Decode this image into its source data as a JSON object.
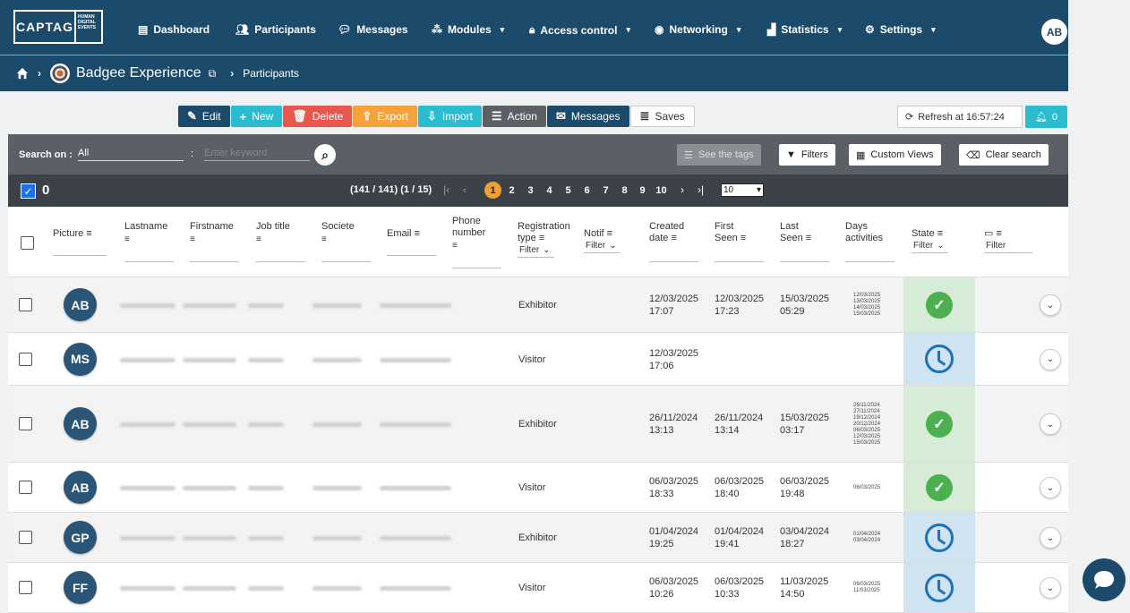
{
  "logo": {
    "main": "CAPTAG",
    "sub1": "HUMAN",
    "sub2": "DIGITAL",
    "sub3": "EVENTS"
  },
  "nav": [
    {
      "label": "Dashboard",
      "icon": "dashboard-icon"
    },
    {
      "label": "Participants",
      "icon": "users-icon"
    },
    {
      "label": "Messages",
      "icon": "chat-icon"
    },
    {
      "label": "Modules",
      "icon": "modules-icon"
    },
    {
      "label": "Access control",
      "icon": "lock-icon"
    },
    {
      "label": "Networking",
      "icon": "location-icon"
    },
    {
      "label": "Statistics",
      "icon": "chart-icon"
    },
    {
      "label": "Settings",
      "icon": "gear-icon"
    }
  ],
  "user": {
    "initials": "AB"
  },
  "breadcrumb": {
    "event": "Badgee Experience",
    "page": "Participants"
  },
  "toolbar": {
    "edit": "Edit",
    "new": "New",
    "delete": "Delete",
    "export": "Export",
    "import": "Import",
    "action": "Action",
    "messages": "Messages",
    "saves": "Saves"
  },
  "refresh": {
    "label": "Refresh at 16:57:24"
  },
  "notifications": {
    "count": "0"
  },
  "search": {
    "label": "Search on :",
    "field": "All",
    "colon": ":",
    "placeholder": "Enter keyword"
  },
  "search_buttons": {
    "tags": "See the tags",
    "filters": "Filters",
    "views": "Custom Views",
    "clear": "Clear search"
  },
  "pager": {
    "selected": "0",
    "info": "(141 / 141) (1 / 15)",
    "pages": [
      "1",
      "2",
      "3",
      "4",
      "5",
      "6",
      "7",
      "8",
      "9",
      "10"
    ],
    "per_page": "10"
  },
  "columns": {
    "picture": "Picture",
    "lastname": "Lastname",
    "firstname": "Firstname",
    "jobtitle": "Job title",
    "societe": "Societe",
    "email": "Email",
    "phone1": "Phone",
    "phone2": "number",
    "regtype1": "Registration",
    "regtype2": "type",
    "notif": "Notif",
    "created1": "Created",
    "created2": "date",
    "first1": "First",
    "first2": "Seen",
    "last1": "Last",
    "last2": "Seen",
    "days1": "Days",
    "days2": "activities",
    "state": "State",
    "filter": "Filter"
  },
  "rows": [
    {
      "initials": "AB",
      "type": "Exhibitor",
      "created": [
        "12/03/2025",
        "17:07"
      ],
      "first": [
        "12/03/2025",
        "17:23"
      ],
      "last": [
        "15/03/2025",
        "05:29"
      ],
      "days": [
        "12/03/2025",
        "13/03/2025",
        "14/03/2025",
        "15/03/2025"
      ],
      "state": "ok"
    },
    {
      "initials": "MS",
      "type": "Visitor",
      "created": [
        "12/03/2025",
        "17:06"
      ],
      "first": [
        "",
        ""
      ],
      "last": [
        "",
        ""
      ],
      "days": [],
      "state": "wait"
    },
    {
      "initials": "AB",
      "type": "Exhibitor",
      "created": [
        "26/11/2024",
        "13:13"
      ],
      "first": [
        "26/11/2024",
        "13:14"
      ],
      "last": [
        "15/03/2025",
        "03:17"
      ],
      "days": [
        "26/11/2024",
        "27/11/2024",
        "19/12/2024",
        "20/12/2024",
        "06/03/2025",
        "12/03/2025",
        "15/03/2025"
      ],
      "state": "ok"
    },
    {
      "initials": "AB",
      "type": "Visitor",
      "created": [
        "06/03/2025",
        "18:33"
      ],
      "first": [
        "06/03/2025",
        "18:40"
      ],
      "last": [
        "06/03/2025",
        "19:48"
      ],
      "days": [
        "06/03/2025"
      ],
      "state": "ok"
    },
    {
      "initials": "GP",
      "type": "Exhibitor",
      "created": [
        "01/04/2024",
        "19:25"
      ],
      "first": [
        "01/04/2024",
        "19:41"
      ],
      "last": [
        "03/04/2024",
        "18:27"
      ],
      "days": [
        "01/04/2024",
        "03/04/2024"
      ],
      "state": "wait"
    },
    {
      "initials": "FF",
      "type": "Visitor",
      "created": [
        "06/03/2025",
        "10:26"
      ],
      "first": [
        "06/03/2025",
        "10:33"
      ],
      "last": [
        "11/03/2025",
        "14:50"
      ],
      "days": [
        "06/03/2025",
        "11/03/2025"
      ],
      "state": "wait"
    }
  ],
  "colors": {
    "header": "#1c4a6b",
    "edit": "#1c4a6b",
    "new": "#2bbcd0",
    "delete": "#e8574d",
    "export": "#f5a23a",
    "import": "#2bbcd0",
    "action": "#5a6066",
    "messages": "#1c4a6b",
    "ok": "#4caf50",
    "pending": "#1a73b8",
    "current_page": "#f0a030"
  }
}
